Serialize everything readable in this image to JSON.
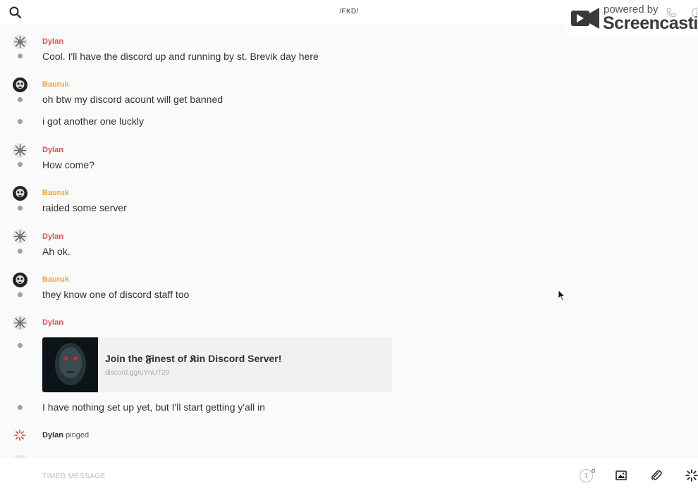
{
  "header": {
    "room_title": "/FKD/",
    "search_icon": "search-icon"
  },
  "watermark": {
    "line1": "powered by",
    "line2": "Screencastify"
  },
  "messages": [
    {
      "author": "Dylan",
      "text": "Cool. I'll have the discord up and running by st. Brevik day here"
    },
    {
      "author": "Bauruk",
      "text": "oh btw my discord acount will get banned"
    },
    {
      "text": "i got another one luckly"
    },
    {
      "author": "Dylan",
      "text": "How come?"
    },
    {
      "author": "Bauruk",
      "text": "raided some server"
    },
    {
      "author": "Dylan",
      "text": "Ah ok."
    },
    {
      "author": "Bauruk",
      "text": "they know one of discord staff too"
    },
    {
      "author": "Dylan"
    },
    {
      "text": "I have nothing set up yet, but I'll start getting y'all in"
    }
  ],
  "embed": {
    "title": "Join the 𝕱inest of 𝕶in Discord Server!",
    "url": "discord.gg/uYnUT29"
  },
  "ping": {
    "author": "Dylan",
    "action": "pinged"
  },
  "composer": {
    "placeholder": "TIMED MESSAGE",
    "timer_value": "1",
    "timer_unit": "d",
    "icons": [
      "image-icon",
      "paperclip-icon",
      "ping-icon"
    ]
  },
  "colors": {
    "dylan": "#e0504a",
    "bauruk": "#f2a33a",
    "background": "#fafafa"
  }
}
